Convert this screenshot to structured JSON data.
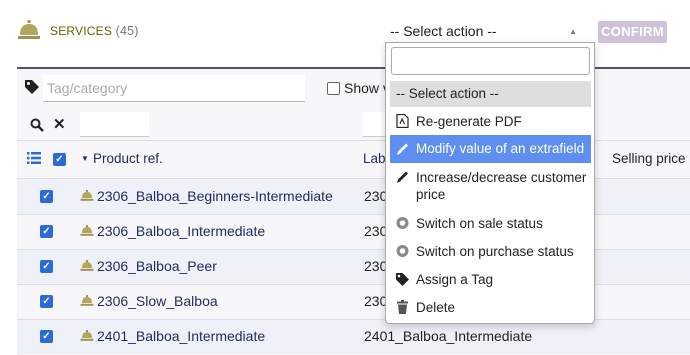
{
  "header": {
    "title": "SERVICES",
    "count": "(45)",
    "select_value": "-- Select action --",
    "confirm_label": "CONFIRM"
  },
  "filters": {
    "tag_placeholder": "Tag/category",
    "show_label": "Show v"
  },
  "columns": {
    "product_ref": "Product ref.",
    "label": "Lab",
    "selling_price": "Selling price"
  },
  "rows": [
    {
      "ref": "2306_Balboa_Beginners-Intermediate",
      "label": "230",
      "checked": true
    },
    {
      "ref": "2306_Balboa_Intermediate",
      "label": "230",
      "checked": true
    },
    {
      "ref": "2306_Balboa_Peer",
      "label": "230",
      "checked": true
    },
    {
      "ref": "2306_Slow_Balboa",
      "label": "230",
      "checked": true
    },
    {
      "ref": "2401_Balboa_Intermediate",
      "label": "2401_Balboa_Intermediate",
      "checked": true
    }
  ],
  "dropdown": {
    "search_value": "",
    "items": [
      {
        "label": "-- Select action --",
        "icon": ""
      },
      {
        "label": "Re-generate PDF",
        "icon": "pdf-icon"
      },
      {
        "label": "Modify value of an extrafield",
        "icon": "pencil-icon"
      },
      {
        "label": "Increase/decrease customer price",
        "icon": "pencil-icon"
      },
      {
        "label": "Switch on sale status",
        "icon": "toggle-circle-icon"
      },
      {
        "label": "Switch on purchase status",
        "icon": "toggle-circle-icon"
      },
      {
        "label": "Assign a Tag",
        "icon": "tag-icon"
      },
      {
        "label": "Delete",
        "icon": "trash-icon"
      }
    ],
    "highlighted": "Modify value of an extrafield"
  },
  "colors": {
    "accent": "#5e8ff0",
    "checkbox": "#2c6bd6",
    "link": "#232d5d",
    "bell": "#b3a65c",
    "confirm_disabled": "#cfc3d9"
  }
}
